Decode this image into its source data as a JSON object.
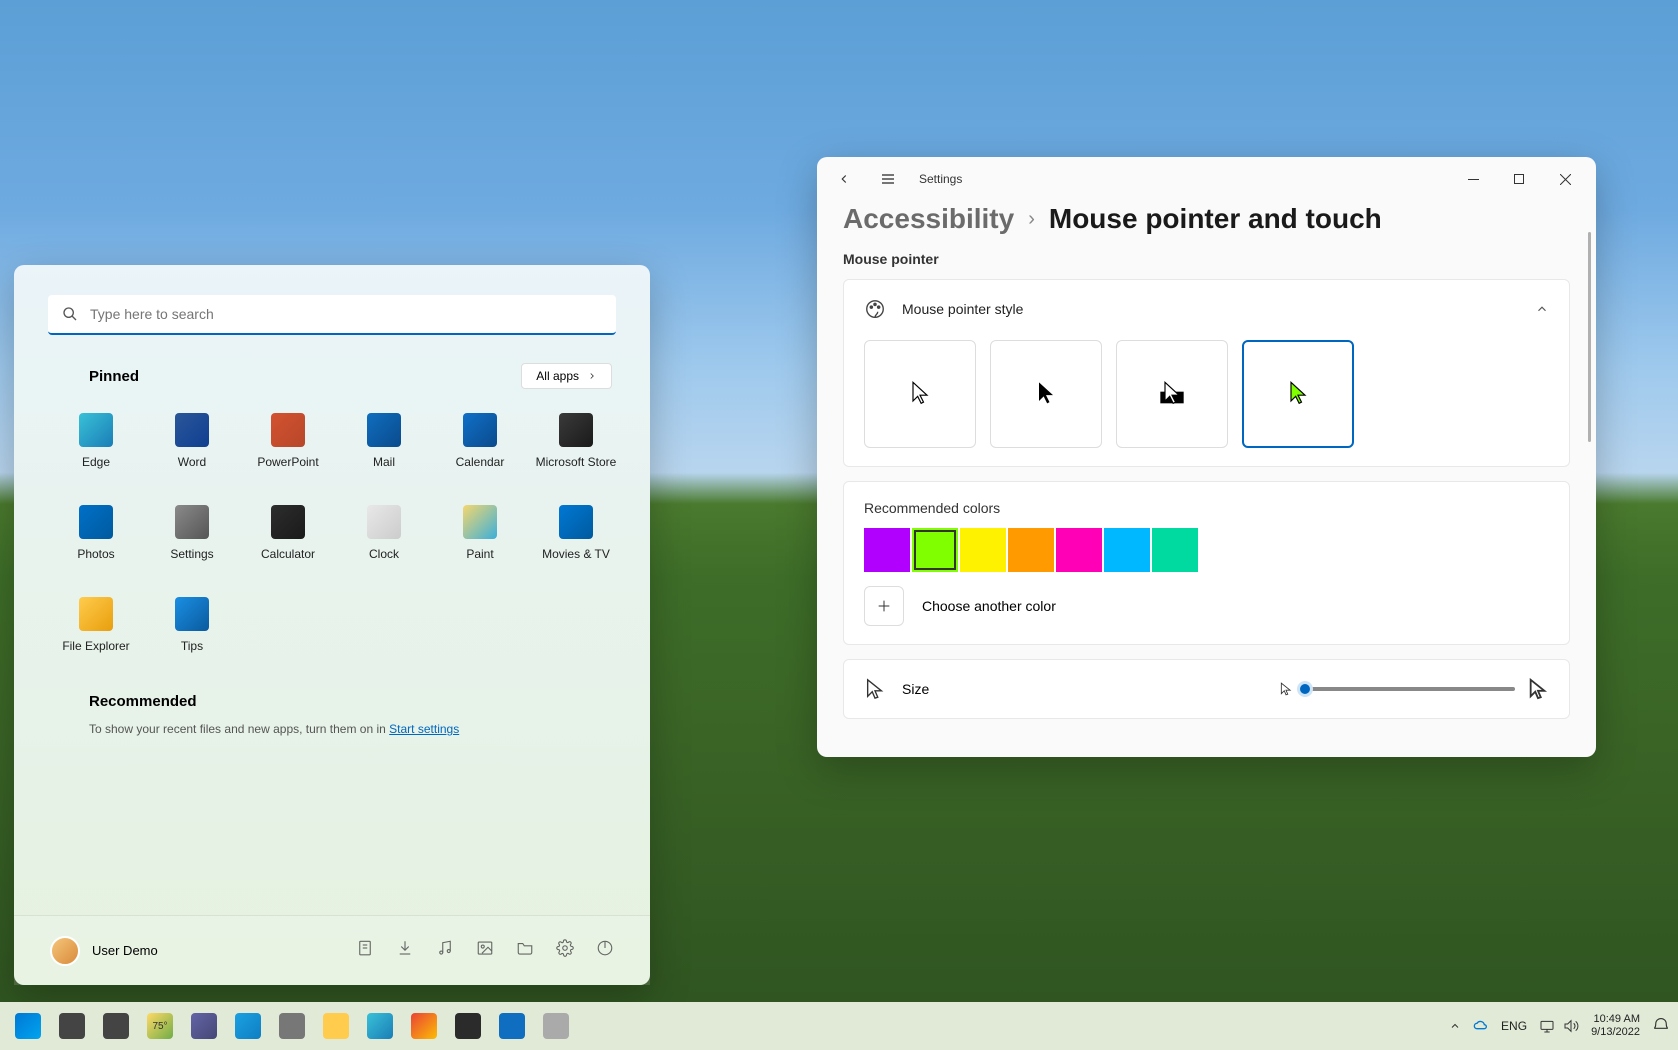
{
  "startMenu": {
    "search_placeholder": "Type here to search",
    "pinned_label": "Pinned",
    "all_apps_label": "All apps",
    "apps": [
      {
        "label": "Edge",
        "color": "linear-gradient(135deg,#39c1d7,#1a7db7)"
      },
      {
        "label": "Word",
        "color": "linear-gradient(135deg,#2a5699,#103f91)"
      },
      {
        "label": "PowerPoint",
        "color": "linear-gradient(135deg,#d35230,#b7472a)"
      },
      {
        "label": "Mail",
        "color": "linear-gradient(135deg,#0f6ebf,#0a4a8c)"
      },
      {
        "label": "Calendar",
        "color": "linear-gradient(135deg,#1070c8,#0a4a8c)"
      },
      {
        "label": "Microsoft Store",
        "color": "linear-gradient(135deg,#3a3a3a,#1a1a1a)"
      },
      {
        "label": "Photos",
        "color": "linear-gradient(135deg,#0070c8,#005a9e)"
      },
      {
        "label": "Settings",
        "color": "linear-gradient(135deg,#8a8a8a,#555)"
      },
      {
        "label": "Calculator",
        "color": "linear-gradient(135deg,#2d2d2d,#1a1a1a)"
      },
      {
        "label": "Clock",
        "color": "linear-gradient(135deg,#e8e8e8,#ccc)"
      },
      {
        "label": "Paint",
        "color": "linear-gradient(135deg,#f5d76e,#3bafda)"
      },
      {
        "label": "Movies & TV",
        "color": "linear-gradient(135deg,#0078d4,#005a9e)"
      },
      {
        "label": "File Explorer",
        "color": "linear-gradient(135deg,#ffcc4d,#e89e0c)"
      },
      {
        "label": "Tips",
        "color": "linear-gradient(135deg,#1a8fe3,#0a5a9e)"
      }
    ],
    "recommended_label": "Recommended",
    "recommended_text_prefix": "To show your recent files and new apps, turn them on in ",
    "recommended_link": "Start settings",
    "user_name": "User Demo",
    "footer_icons": [
      "document-icon",
      "download-icon",
      "music-icon",
      "pictures-icon",
      "folder-icon",
      "settings-icon",
      "power-icon"
    ]
  },
  "settings": {
    "app_title": "Settings",
    "breadcrumb_parent": "Accessibility",
    "breadcrumb_current": "Mouse pointer and touch",
    "section_mouse_pointer": "Mouse pointer",
    "style_label": "Mouse pointer style",
    "style_selected_index": 3,
    "recommended_colors_label": "Recommended colors",
    "colors": [
      "#b200ff",
      "#7fff00",
      "#fff200",
      "#ff9b00",
      "#ff00b6",
      "#00b8ff",
      "#00d9a0"
    ],
    "selected_color_index": 1,
    "choose_another_label": "Choose another color",
    "size_label": "Size",
    "size_value": 1
  },
  "taskbar": {
    "items": [
      {
        "name": "start-button",
        "color": "linear-gradient(135deg,#0078d4,#00a4ef)"
      },
      {
        "name": "search-button",
        "color": "#444"
      },
      {
        "name": "task-view-button",
        "color": "#444"
      },
      {
        "name": "widgets-button",
        "color": "linear-gradient(135deg,#ffd966,#70ad47)",
        "text": "75°"
      },
      {
        "name": "teams-button",
        "color": "linear-gradient(135deg,#6264a7,#464775)"
      },
      {
        "name": "chat-button",
        "color": "linear-gradient(135deg,#1ba1e2,#0e7ec2)"
      },
      {
        "name": "settings-taskbar",
        "color": "#777"
      },
      {
        "name": "file-explorer-taskbar",
        "color": "#ffcc4d"
      },
      {
        "name": "edge-taskbar",
        "color": "linear-gradient(135deg,#39c1d7,#1a7db7)"
      },
      {
        "name": "chrome-taskbar",
        "color": "linear-gradient(135deg,#ea4335,#fbbc05)"
      },
      {
        "name": "terminal-taskbar",
        "color": "#2b2b2b"
      },
      {
        "name": "outlook-taskbar",
        "color": "#0f6ebf"
      },
      {
        "name": "fences-taskbar",
        "color": "#aaa"
      }
    ],
    "tray": {
      "lang": "ENG",
      "time": "10:49 AM",
      "date": "9/13/2022"
    }
  }
}
